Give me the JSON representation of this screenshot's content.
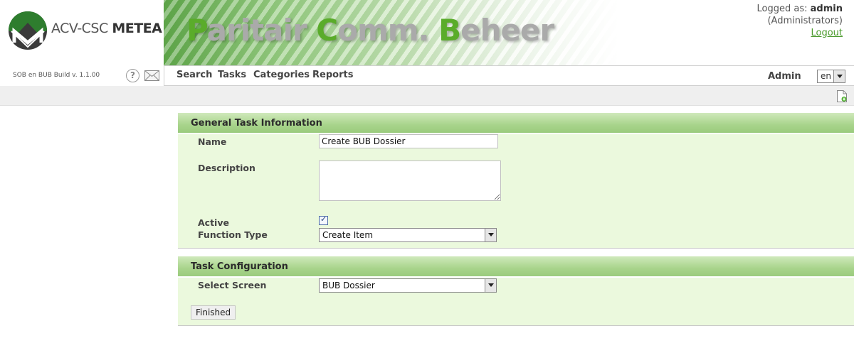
{
  "brand": {
    "logo_prefix": "ACV-CSC ",
    "logo_bold": "METEA",
    "banner_title_p": "P",
    "banner_title_1": "aritair ",
    "banner_title_c": "C",
    "banner_title_2": "omm. ",
    "banner_title_b": "B",
    "banner_title_3": "eheer",
    "build": "SOB en BUB Build v. 1.1.00"
  },
  "user": {
    "logged_as_prefix": "Logged as: ",
    "username": "admin",
    "role": "(Administrators)",
    "logout": "Logout"
  },
  "nav": {
    "items": [
      "Search",
      "Tasks",
      "Categories",
      "Reports"
    ],
    "admin": "Admin",
    "language": "en"
  },
  "icons": {
    "help": "help-icon",
    "mail": "mail-icon",
    "add": "add-document-icon"
  },
  "general_panel": {
    "title": "General Task Information",
    "name_label": "Name",
    "name_value": "Create BUB Dossier",
    "description_label": "Description",
    "description_value": "",
    "active_label": "Active",
    "active_checked": true,
    "function_type_label": "Function Type",
    "function_type_value": "Create Item"
  },
  "config_panel": {
    "title": "Task Configuration",
    "select_screen_label": "Select Screen",
    "select_screen_value": "BUB Dossier",
    "finished_button": "Finished"
  },
  "colors": {
    "accent_green": "#5aac2a",
    "panel_bg": "#ebf9dd",
    "panel_header": "#a8d48b"
  }
}
